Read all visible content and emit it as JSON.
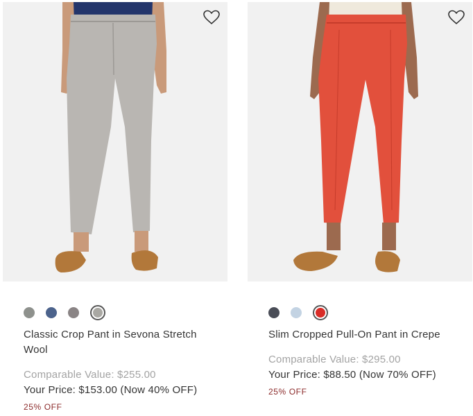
{
  "products": [
    {
      "title": "Classic Crop Pant in Sevona Stretch Wool",
      "comparable": "Comparable Value: $255.00",
      "your_price": "Your Price: $153.00 (Now 40% OFF)",
      "discount": "25% OFF",
      "pant_color": "#b9b6b2",
      "top_color": "#23356b",
      "swatches": [
        "#8e918d",
        "#4c638c",
        "#8a8485",
        "#a9a8a3"
      ],
      "selected_swatch": 3,
      "favorite_icon": "heart-outline-icon"
    },
    {
      "title": "Slim Cropped Pull-On Pant in Crepe",
      "comparable": "Comparable Value: $295.00",
      "your_price": "Your Price: $88.50 (Now 70% OFF)",
      "discount": "25% OFF",
      "pant_color": "#e2503c",
      "top_color": "#efe9dc",
      "swatches": [
        "#4a4d57",
        "#c3d3e3",
        "#d92c27"
      ],
      "selected_swatch": 2,
      "favorite_icon": "heart-outline-icon"
    }
  ]
}
